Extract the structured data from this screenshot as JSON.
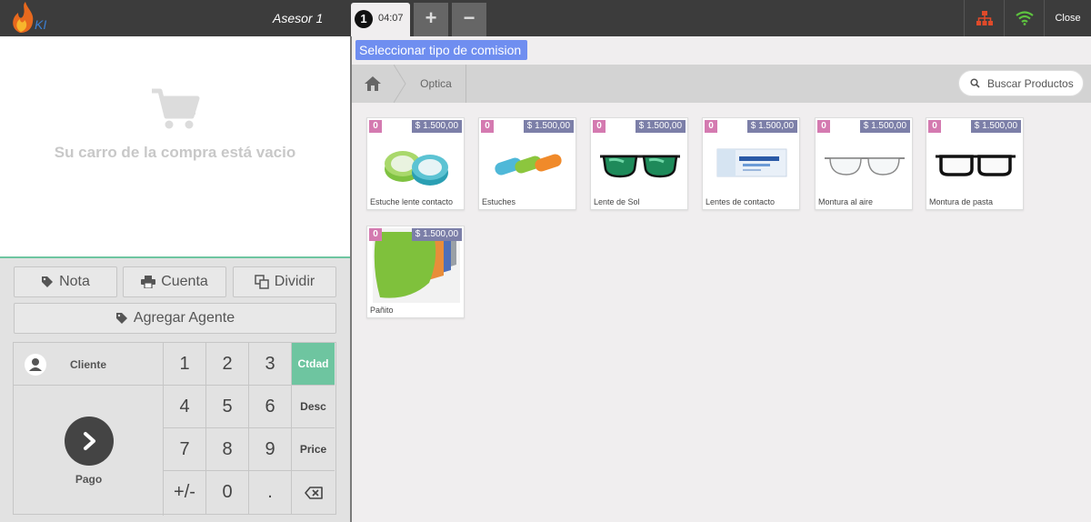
{
  "header": {
    "user": "Asesor 1",
    "order": {
      "number": "1",
      "time": "04:07"
    },
    "add_order_label": "+",
    "remove_order_label": "−",
    "close_label": "Close",
    "colors": {
      "network_icon": "#e04a2a",
      "wifi_icon": "#5ec23f"
    }
  },
  "cart": {
    "empty_message": "Su carro de la compra está vacio"
  },
  "actions": {
    "nota": "Nota",
    "cuenta": "Cuenta",
    "dividir": "Dividir",
    "agregar_agente": "Agregar Agente"
  },
  "numpad": {
    "cliente": "Cliente",
    "pago": "Pago",
    "keys": [
      "1",
      "2",
      "3",
      "Ctdad",
      "4",
      "5",
      "6",
      "Desc",
      "7",
      "8",
      "9",
      "Price",
      "+/-",
      "0",
      "."
    ],
    "backspace_icon": "backspace-icon",
    "active_mode_color": "#6ec5a0"
  },
  "commission_selector": {
    "label": "Seleccionar tipo de comision ▾",
    "color": "#6f8ef0"
  },
  "breadcrumb": {
    "home_icon": "home-icon",
    "category": "Optica"
  },
  "search": {
    "placeholder": "Buscar Productos"
  },
  "products": [
    {
      "qty": "0",
      "price": "$ 1.500,00",
      "name": "Estuche lente contacto"
    },
    {
      "qty": "0",
      "price": "$ 1.500,00",
      "name": "Estuches"
    },
    {
      "qty": "0",
      "price": "$ 1.500,00",
      "name": "Lente de Sol"
    },
    {
      "qty": "0",
      "price": "$ 1.500,00",
      "name": "Lentes de contacto"
    },
    {
      "qty": "0",
      "price": "$ 1.500,00",
      "name": "Montura al aire"
    },
    {
      "qty": "0",
      "price": "$ 1.500,00",
      "name": "Montura de pasta"
    },
    {
      "qty": "0",
      "price": "$ 1.500,00",
      "name": "Pañito"
    }
  ]
}
